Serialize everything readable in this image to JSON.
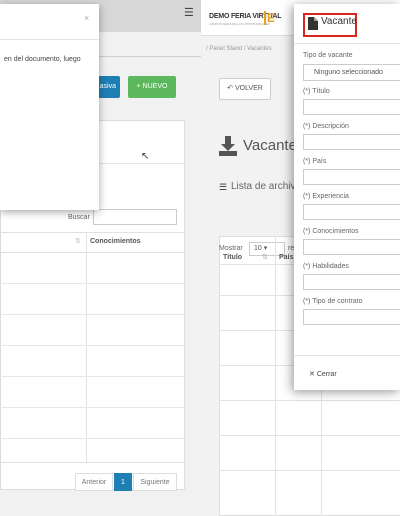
{
  "left_window": {
    "menu_icon": "hamburger-menu-icon",
    "btn_masiva": "asiva",
    "btn_nuevo": "+ NUEVO",
    "search_label": "Buscar",
    "col_conocimientos": "Conocimientos",
    "pagination": {
      "prev": "Anterior",
      "page": "1",
      "next": "Siguiente"
    },
    "modal": {
      "close": "×",
      "text": "en del documento, luego"
    }
  },
  "right_window": {
    "brand": "DEMO FERIA VIRTUAL",
    "brand_sub": "CAMPUS FERIA DE LAS OPORTUNIDADES",
    "brand_logo": "E",
    "breadcrumb": "/ Panel Stand / Vacantes",
    "volver": "VOLVER",
    "page_title": "Vacante",
    "lista_label": "Lista de archivo",
    "mostrar": "Mostrar",
    "mostrar_value": "10",
    "registros": "re",
    "table": {
      "col_titulo": "Título",
      "col_pais": "País"
    }
  },
  "modal": {
    "title": "Vacante",
    "fields": {
      "tipo_label": "Tipo de vacante",
      "tipo_value": "Ninguno seleccionado",
      "titulo_label": "(*) Título",
      "descripcion_label": "(*) Descripción",
      "pais_label": "(*) País",
      "experiencia_label": "(*) Experiencia",
      "conocimientos_label": "(*) Conocimientos",
      "habilidades_label": "(*) Habilidades",
      "contrato_label": "(*) Tipo de contrato"
    },
    "close_button": "Cerrar"
  },
  "colors": {
    "accent_blue": "#1e7fb5",
    "success_green": "#5cb85c",
    "highlight_red": "#d9261c",
    "brand_gold": "#e4a21a"
  }
}
